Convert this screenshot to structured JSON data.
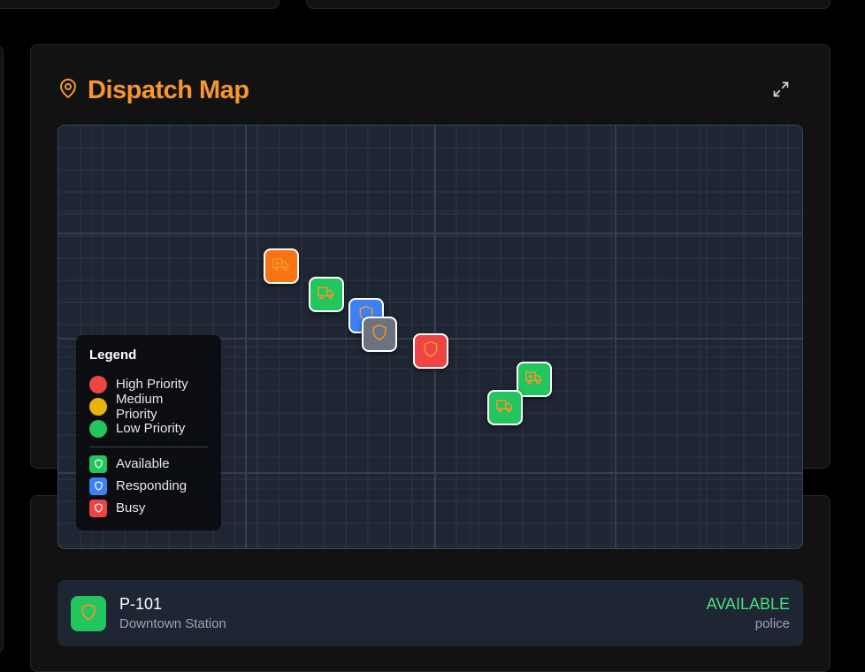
{
  "header": {
    "title": "Dispatch Map",
    "icon": "map-pin-icon",
    "expand_icon": "expand-icon"
  },
  "colors": {
    "accent": "#f6962b",
    "high": "#ef4444",
    "medium": "#eab308",
    "low": "#22c55e",
    "available": "#22c55e",
    "responding": "#3b82f6",
    "busy": "#ef4444",
    "offline": "#6b7280",
    "incident": "#f97316"
  },
  "map": {
    "markers": [
      {
        "name": "map-marker-ambulance-incident",
        "icon": "ambulance-icon",
        "color": "#f97316"
      },
      {
        "name": "map-marker-truck-available",
        "icon": "truck-icon",
        "color": "#22c55e"
      },
      {
        "name": "map-marker-police-responding",
        "icon": "shield-icon",
        "color": "#3b82f6"
      },
      {
        "name": "map-marker-police-offline",
        "icon": "shield-icon",
        "color": "#6b7280"
      },
      {
        "name": "map-marker-police-busy",
        "icon": "shield-icon",
        "color": "#ef4444"
      },
      {
        "name": "map-marker-ambulance-available",
        "icon": "ambulance-icon",
        "color": "#22c55e"
      },
      {
        "name": "map-marker-truck-available-2",
        "icon": "truck-icon",
        "color": "#22c55e"
      }
    ]
  },
  "legend": {
    "title": "Legend",
    "priorities": [
      {
        "label": "High Priority"
      },
      {
        "label": "Medium Priority"
      },
      {
        "label": "Low Priority"
      }
    ],
    "statuses": [
      {
        "label": "Available"
      },
      {
        "label": "Responding"
      },
      {
        "label": "Busy"
      }
    ]
  },
  "units": [
    {
      "id": "P-101",
      "station": "Downtown Station",
      "status": "AVAILABLE",
      "type": "police",
      "icon": "shield-icon"
    }
  ]
}
